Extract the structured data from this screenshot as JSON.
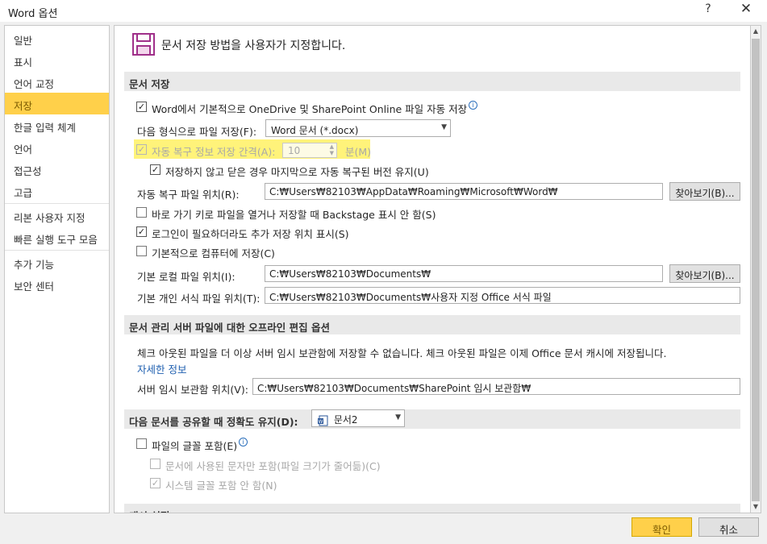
{
  "window": {
    "title": "Word 옵션",
    "help": "?",
    "close": "✕"
  },
  "nav": {
    "items": [
      "일반",
      "표시",
      "언어 교정",
      "저장",
      "한글 입력 체계",
      "언어",
      "접근성",
      "고급",
      "리본 사용자 지정",
      "빠른 실행 도구 모음",
      "추가 기능",
      "보안 센터"
    ],
    "selected": "저장"
  },
  "header": {
    "text": "문서 저장 방법을 사용자가 지정합니다."
  },
  "save_section": {
    "title": "문서 저장",
    "autosave_label": "Word에서 기본적으로 OneDrive 및 SharePoint Online 파일 자동 저장",
    "autosave_checked": true,
    "format_label": "다음 형식으로 파일 저장(F):",
    "format_value": "Word 문서 (*.docx)",
    "autorecover_label": "자동 복구 정보 저장 간격(A):",
    "autorecover_checked": true,
    "autorecover_value": "10",
    "autorecover_unit": "분(M)",
    "keep_last_label": "저장하지 않고 닫은 경우 마지막으로 자동 복구된 버전 유지(U)",
    "keep_last_checked": true,
    "autorecover_location_label": "자동 복구 파일 위치(R):",
    "autorecover_location_value": "C:₩Users₩82103₩AppData₩Roaming₩Microsoft₩Word₩",
    "browse_label": "찾아보기(B)...",
    "backstage_label": "바로 가기 키로 파일을 열거나 저장할 때 Backstage 표시 안 함(S)",
    "backstage_checked": false,
    "additional_places_label": "로그인이 필요하더라도 추가 저장 위치 표시(S)",
    "additional_places_checked": true,
    "save_to_computer_label": "기본적으로 컴퓨터에 저장(C)",
    "save_to_computer_checked": false,
    "local_location_label": "기본 로컬 파일 위치(I):",
    "local_location_value": "C:₩Users₩82103₩Documents₩",
    "browse_label_2": "찾아보기(B)...",
    "templates_location_label": "기본 개인 서식 파일 위치(T):",
    "templates_location_value": "C:₩Users₩82103₩Documents₩사용자 지정 Office 서식 파일"
  },
  "offline_section": {
    "title": "문서 관리 서버 파일에 대한 오프라인 편집 옵션",
    "description": "체크 아웃된 파일을 더 이상 서버 임시 보관함에 저장할 수 없습니다. 체크 아웃된 파일은 이제 Office 문서 캐시에 저장됩니다.",
    "more_info": "자세한 정보",
    "drafts_label": "서버 임시 보관함 위치(V):",
    "drafts_value": "C:₩Users₩82103₩Documents₩SharePoint 임시 보관함₩"
  },
  "fidelity_section": {
    "title": "다음 문서를 공유할 때 정확도 유지(D):",
    "doc_value": "문서2",
    "embed_fonts_label": "파일의 글꼴 포함(E)",
    "embed_fonts_checked": false,
    "embed_used_only_label": "문서에 사용된 문자만 포함(파일 크기가 줄어듦)(C)",
    "embed_used_only_checked": false,
    "no_system_fonts_label": "시스템 글꼴 포함 안 함(N)",
    "no_system_fonts_checked": true
  },
  "cache_section": {
    "title": "캐시 설정"
  },
  "footer": {
    "ok": "확인",
    "cancel": "취소"
  },
  "colors": {
    "accent": "#ffd04a",
    "highlight": "#fff37a",
    "link": "#2060b0"
  }
}
